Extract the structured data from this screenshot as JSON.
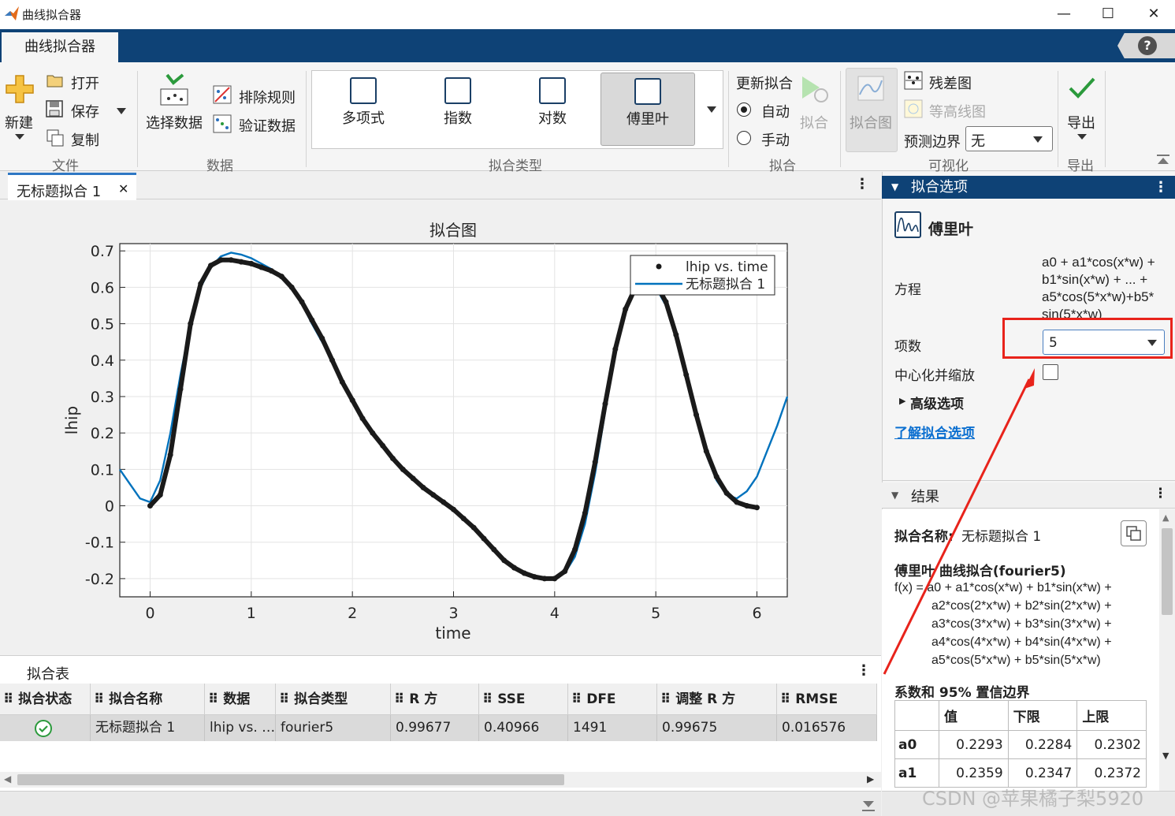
{
  "window": {
    "title": "曲线拟合器",
    "minimize": "—",
    "maximize": "☐",
    "close": "✕"
  },
  "app_tab": "曲线拟合器",
  "help_label": "?",
  "ribbon": {
    "file": {
      "new": "新建",
      "open": "打开",
      "save": "保存",
      "copy": "复制",
      "section": "文件"
    },
    "data": {
      "select": "选择数据",
      "exclude": "排除规则",
      "validate": "验证数据",
      "section": "数据"
    },
    "fit_type": {
      "items": [
        "多项式",
        "指数",
        "对数",
        "傅里叶"
      ],
      "selected": "傅里叶",
      "section": "拟合类型"
    },
    "fit": {
      "update": "更新拟合",
      "auto": "自动",
      "manual": "手动",
      "fit_button": "拟合",
      "section": "拟合"
    },
    "viz": {
      "fit_plot": "拟合图",
      "residual": "残差图",
      "contour": "等高线图",
      "pred_bounds_label": "预测边界",
      "pred_bounds_value": "无",
      "section": "可视化"
    },
    "export": {
      "label": "导出",
      "section": "导出"
    }
  },
  "doc_tab": {
    "label": "无标题拟合 1",
    "close": "✕"
  },
  "chart_data": {
    "type": "line",
    "title": "拟合图",
    "xlabel": "time",
    "ylabel": "lhip",
    "xlim": [
      -0.3,
      6.3
    ],
    "ylim": [
      -0.25,
      0.72
    ],
    "xticks": [
      0,
      1,
      2,
      3,
      4,
      5,
      6
    ],
    "yticks": [
      -0.2,
      -0.1,
      0,
      0.1,
      0.2,
      0.3,
      0.4,
      0.5,
      0.6,
      0.7
    ],
    "grid": true,
    "legend_position": "top-right",
    "legend": [
      "lhip vs. time",
      "无标题拟合 1"
    ],
    "series": [
      {
        "name": "lhip vs. time",
        "kind": "points",
        "color": "#1a1a1a",
        "x": [
          0,
          0.1,
          0.2,
          0.3,
          0.4,
          0.5,
          0.6,
          0.7,
          0.8,
          0.9,
          1.0,
          1.1,
          1.2,
          1.3,
          1.4,
          1.5,
          1.6,
          1.7,
          1.8,
          1.9,
          2.0,
          2.1,
          2.2,
          2.3,
          2.4,
          2.5,
          2.6,
          2.7,
          2.8,
          2.9,
          3.0,
          3.1,
          3.2,
          3.3,
          3.4,
          3.5,
          3.6,
          3.7,
          3.8,
          3.9,
          4.0,
          4.1,
          4.2,
          4.3,
          4.4,
          4.5,
          4.6,
          4.7,
          4.8,
          4.9,
          5.0,
          5.1,
          5.2,
          5.3,
          5.4,
          5.5,
          5.6,
          5.7,
          5.8,
          5.9,
          6.0
        ],
        "y": [
          0.0,
          0.03,
          0.14,
          0.32,
          0.5,
          0.61,
          0.66,
          0.675,
          0.675,
          0.67,
          0.665,
          0.655,
          0.645,
          0.63,
          0.6,
          0.56,
          0.51,
          0.46,
          0.4,
          0.34,
          0.29,
          0.24,
          0.2,
          0.165,
          0.13,
          0.1,
          0.075,
          0.05,
          0.03,
          0.01,
          -0.01,
          -0.035,
          -0.06,
          -0.09,
          -0.12,
          -0.15,
          -0.17,
          -0.185,
          -0.195,
          -0.2,
          -0.2,
          -0.18,
          -0.12,
          -0.02,
          0.12,
          0.28,
          0.43,
          0.54,
          0.6,
          0.62,
          0.61,
          0.56,
          0.47,
          0.36,
          0.25,
          0.15,
          0.08,
          0.035,
          0.01,
          0.0,
          -0.005
        ]
      },
      {
        "name": "无标题拟合 1",
        "kind": "line",
        "color": "#0072bd",
        "x": [
          -0.3,
          -0.2,
          -0.1,
          0.0,
          0.1,
          0.2,
          0.3,
          0.4,
          0.5,
          0.6,
          0.7,
          0.8,
          0.9,
          1.0,
          1.1,
          1.2,
          1.3,
          1.4,
          1.5,
          1.6,
          1.7,
          1.8,
          1.9,
          2.0,
          2.1,
          2.2,
          2.3,
          2.4,
          2.5,
          2.6,
          2.7,
          2.8,
          2.9,
          3.0,
          3.1,
          3.2,
          3.3,
          3.4,
          3.5,
          3.6,
          3.7,
          3.8,
          3.9,
          4.0,
          4.1,
          4.2,
          4.3,
          4.4,
          4.5,
          4.6,
          4.7,
          4.8,
          4.9,
          5.0,
          5.1,
          5.2,
          5.3,
          5.4,
          5.5,
          5.6,
          5.7,
          5.8,
          5.9,
          6.0,
          6.1,
          6.2,
          6.3
        ],
        "y": [
          0.1,
          0.06,
          0.02,
          0.01,
          0.07,
          0.2,
          0.36,
          0.5,
          0.6,
          0.655,
          0.685,
          0.695,
          0.69,
          0.68,
          0.665,
          0.65,
          0.625,
          0.595,
          0.555,
          0.5,
          0.45,
          0.4,
          0.345,
          0.295,
          0.245,
          0.2,
          0.165,
          0.13,
          0.1,
          0.075,
          0.05,
          0.03,
          0.01,
          -0.01,
          -0.035,
          -0.06,
          -0.09,
          -0.12,
          -0.15,
          -0.17,
          -0.185,
          -0.195,
          -0.2,
          -0.2,
          -0.185,
          -0.14,
          -0.05,
          0.09,
          0.26,
          0.42,
          0.54,
          0.61,
          0.62,
          0.6,
          0.55,
          0.46,
          0.35,
          0.24,
          0.14,
          0.07,
          0.03,
          0.02,
          0.04,
          0.08,
          0.15,
          0.22,
          0.3
        ]
      }
    ]
  },
  "table": {
    "title": "拟合表",
    "headers": [
      "拟合状态",
      "拟合名称",
      "数据",
      "拟合类型",
      "R 方",
      "SSE",
      "DFE",
      "调整 R 方",
      "RMSE"
    ],
    "row": {
      "status_icon": "check-circle-icon",
      "name": "无标题拟合 1",
      "data": "lhip vs. …",
      "type": "fourier5",
      "rsq": "0.99677",
      "sse": "0.40966",
      "dfe": "1491",
      "adj_rsq": "0.99675",
      "rmse": "0.016576"
    }
  },
  "fit_options": {
    "header": "拟合选项",
    "model": "傅里叶",
    "equation_label": "方程",
    "equation": [
      "a0 + a1*cos(x*w) +",
      "b1*sin(x*w) + ... +",
      "a5*cos(5*x*w)+b5*",
      "sin(5*x*w)"
    ],
    "terms_label": "项数",
    "terms_value": "5",
    "center_scale_label": "中心化并缩放",
    "advanced": "高级选项",
    "learn_link": "了解拟合选项"
  },
  "results": {
    "header": "结果",
    "fit_name_label": "拟合名称:",
    "fit_name_value": "无标题拟合 1",
    "model_title": "傅里叶 曲线拟合(fourier5)",
    "formula": [
      "f(x) = a0 + a1*cos(x*w) + b1*sin(x*w) +",
      "a2*cos(2*x*w) + b2*sin(2*x*w) +",
      "a3*cos(3*x*w) + b3*sin(3*x*w) +",
      "a4*cos(4*x*w) + b4*sin(4*x*w) +",
      "a5*cos(5*x*w) + b5*sin(5*x*w)"
    ],
    "coef_title": "系数和 95% 置信边界",
    "coef_headers": [
      "",
      "值",
      "下限",
      "上限"
    ],
    "coef_rows": [
      [
        "a0",
        "0.2293",
        "0.2284",
        "0.2302"
      ],
      [
        "a1",
        "0.2359",
        "0.2347",
        "0.2372"
      ]
    ]
  },
  "watermark": "CSDN @苹果橘子梨5920",
  "colors": {
    "accent": "#0e4276",
    "annotation": "#e8231b",
    "fit_line": "#0072bd",
    "link": "#0b6fd0"
  }
}
